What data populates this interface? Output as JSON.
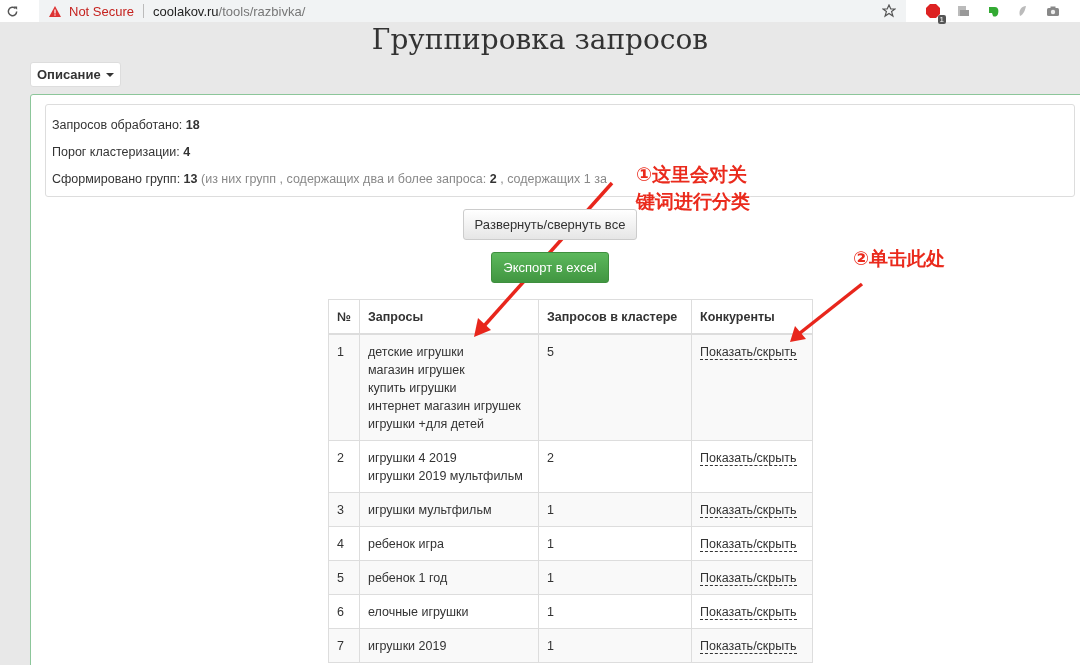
{
  "browser": {
    "security_label": "Not Secure",
    "url_host": "coolakov.ru",
    "url_path": "/tools/razbivka/",
    "extension_badge": "1"
  },
  "page": {
    "title": "Группировка запросов",
    "description_button": "Описание"
  },
  "stats": [
    {
      "kind": "plain",
      "label": "Запросов обработано: ",
      "value": "18"
    },
    {
      "kind": "plain",
      "label": "Порог кластеризации: ",
      "value": "4"
    },
    {
      "kind": "detail",
      "label": "Сформировано групп: ",
      "value": "13",
      "note": "(из них групп , содержащих два и более запроса: **2** , содержащих 1 за"
    }
  ],
  "buttons": {
    "toggle_all": "Развернуть/свернуть все",
    "export": "Экспорт в excel"
  },
  "table": {
    "columns": [
      "№",
      "Запросы",
      "Запросов в кластере",
      "Конкуренты"
    ],
    "rows": [
      {
        "num": "1",
        "queries": [
          "детские игрушки",
          "магазин игрушек",
          "купить игрушки",
          "интернет магазин игрушек",
          "игрушки +для детей"
        ],
        "count": "5",
        "link": "Показать/скрыть"
      },
      {
        "num": "2",
        "queries": [
          "игрушки 4 2019",
          "игрушки 2019 мультфильм"
        ],
        "count": "2",
        "link": "Показать/скрыть"
      },
      {
        "num": "3",
        "queries": [
          "игрушки мультфильм"
        ],
        "count": "1",
        "link": "Показать/скрыть"
      },
      {
        "num": "4",
        "queries": [
          "ребенок игра"
        ],
        "count": "1",
        "link": "Показать/скрыть"
      },
      {
        "num": "5",
        "queries": [
          "ребенок 1 год"
        ],
        "count": "1",
        "link": "Показать/скрыть"
      },
      {
        "num": "6",
        "queries": [
          "елочные игрушки"
        ],
        "count": "1",
        "link": "Показать/скрыть"
      },
      {
        "num": "7",
        "queries": [
          "игрушки 2019"
        ],
        "count": "1",
        "link": "Показать/скрыть"
      }
    ]
  },
  "annotations": [
    {
      "text": "①这里会对关键词进行分类"
    },
    {
      "text": "②单击此处"
    }
  ]
}
